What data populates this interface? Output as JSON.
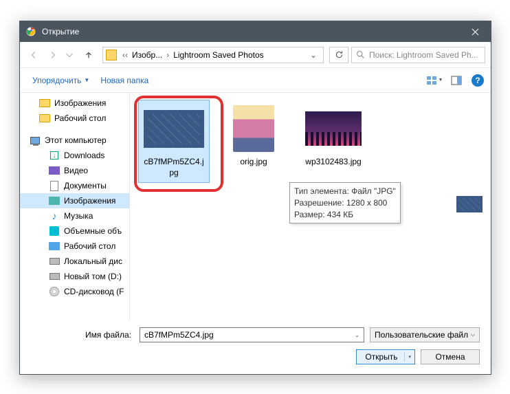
{
  "titlebar": {
    "title": "Открытие"
  },
  "nav": {
    "breadcrumb": {
      "item1": "Изобр...",
      "item2": "Lightroom Saved Photos"
    },
    "search_placeholder": "Поиск: Lightroom Saved Ph..."
  },
  "toolbar": {
    "organize": "Упорядочить",
    "newfolder": "Новая папка"
  },
  "sidebar": {
    "images": "Изображения",
    "desktop": "Рабочий стол",
    "thispc": "Этот компьютер",
    "downloads": "Downloads",
    "video": "Видео",
    "documents": "Документы",
    "images2": "Изображения",
    "music": "Музыка",
    "objects3d": "Объемные объ",
    "desktop2": "Рабочий стол",
    "localdisk": "Локальный дис",
    "newvol": "Новый том (D:)",
    "cddrive": "CD-дисковод (F"
  },
  "files": {
    "f1": "cB7fMPm5ZC4.jpg",
    "f2": "orig.jpg",
    "f3": "wp3102483.jpg"
  },
  "tooltip": {
    "l1": "Тип элемента: Файл \"JPG\"",
    "l2": "Разрешение: 1280 x 800",
    "l3": "Размер: 434 КБ"
  },
  "footer": {
    "filename_label": "Имя файла:",
    "filename_value": "cB7fMPm5ZC4.jpg",
    "filetype": "Пользовательские файлы (*.jf",
    "open": "Открыть",
    "cancel": "Отмена"
  }
}
